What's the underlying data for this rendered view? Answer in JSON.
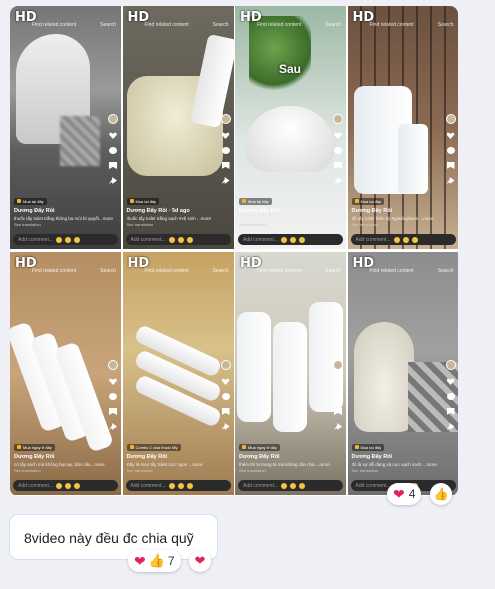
{
  "album": {
    "tiles": [
      {
        "hd": "HD",
        "topbar": {
          "back": "‹",
          "text": "Find related content",
          "search": "Search"
        },
        "tag": "Mua tại đây",
        "author": "Dương Đẩy Rối",
        "caption": "thuốc tẩy toilet trắng thông ba mùi bí quyết...more",
        "translation": "See translation",
        "comment": "Add comment..."
      },
      {
        "hd": "HD",
        "topbar": {
          "back": "‹",
          "text": "Find related content",
          "search": "Search"
        },
        "tag": "Mua tại đây",
        "author": "Dương Đẩy Rối · 5d ago",
        "caption": "thuốc tẩy toilet trắng sạch #vệ sinh ...more",
        "translation": "See translation",
        "comment": "Add comment..."
      },
      {
        "hd": "HD",
        "overlay_text": "Sau",
        "topbar": {
          "back": "‹",
          "text": "Find related content",
          "search": "Search"
        },
        "tag": "Mua tại đây",
        "author": "Dương Đẩy Rối",
        "caption": "Cả nhà ơi cái toilet sạch bóng luôn ạ ...more",
        "translation": "See translation",
        "comment": "Add comment..."
      },
      {
        "hd": "HD",
        "topbar": {
          "back": "‹",
          "text": "Find related content",
          "search": "Search"
        },
        "tag": "Mua tại đây",
        "author": "Dương Đẩy Rối",
        "caption": "đồ tẩy toilet thần kỳ #giadinghiem ...more",
        "translation": "See translation",
        "comment": "Add comment..."
      },
      {
        "hd": "HD",
        "topbar": {
          "back": "‹",
          "text": "Find related content",
          "search": "Search"
        },
        "tag": "Mua ngay ở đây",
        "author": "Dương Đẩy Rối",
        "caption": "có tẩy sạch mà không hại tay, bồn cầu...more",
        "translation": "See translation",
        "comment": "Add comment..."
      },
      {
        "hd": "HD",
        "topbar": {
          "back": "‹",
          "text": "Find related content",
          "search": "Search"
        },
        "tag": "Combo 2 chai thuốc tẩy",
        "author": "Dương Đẩy Rối",
        "caption": "Đây là mẹo tẩy toilet cực ngon ...more",
        "translation": "See translation",
        "comment": "Add comment..."
      },
      {
        "hd": "HD",
        "topbar": {
          "back": "‹",
          "text": "Find related content",
          "search": "Search"
        },
        "tag": "Mua ngay ở đây",
        "author": "Dương Đẩy Rối",
        "caption": "thêm thì lo trong tủ mà không cần chà ...more",
        "translation": "See translation",
        "comment": "Add comment..."
      },
      {
        "hd": "HD",
        "topbar": {
          "back": "‹",
          "text": "Find related content",
          "search": "Search"
        },
        "tag": "Mua tại đây",
        "author": "Dương Đẩy Rối",
        "caption": "đó là sự dễ dàng và cực sạch sạch ...more",
        "translation": "See translation",
        "comment": "Add comment..."
      }
    ],
    "reactions": {
      "heart": "❤",
      "count": "4"
    },
    "like_icon": "👍"
  },
  "message": {
    "text": "8video này đều đc chia quỹ",
    "reactions": {
      "heart": "❤",
      "thumb": "👍",
      "count": "7"
    },
    "react_button_icon": "❤"
  },
  "colors": {
    "heart": "#e0245e",
    "bubble_border": "#cfe0f7",
    "background": "#eef0f5"
  }
}
